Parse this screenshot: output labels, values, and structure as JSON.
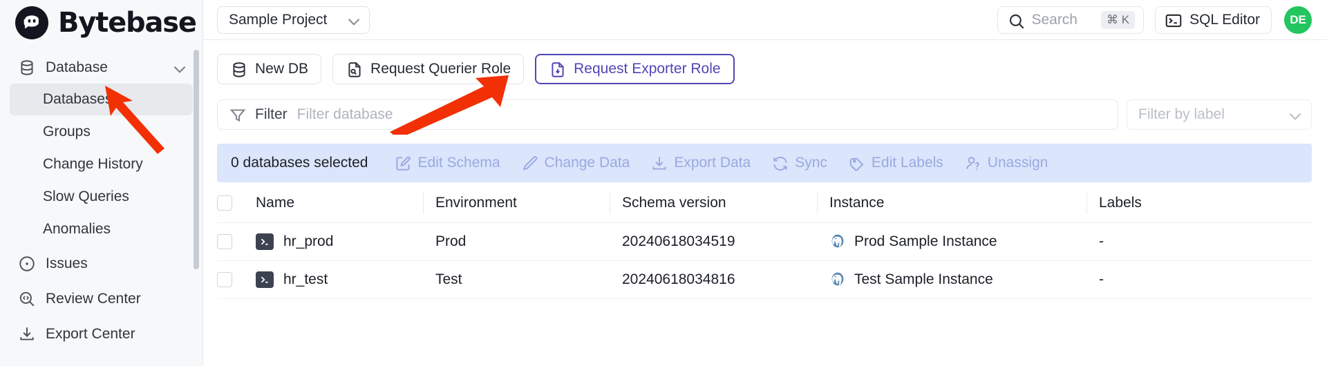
{
  "brand": {
    "name": "Bytebase",
    "logo_icon": "bytebase-logo-icon"
  },
  "sidebar": {
    "group": {
      "label": "Database",
      "icon": "database-icon",
      "chevron": "chevron-down-icon"
    },
    "sub_items": [
      {
        "label": "Databases",
        "active": true
      },
      {
        "label": "Groups",
        "active": false
      },
      {
        "label": "Change History",
        "active": false
      },
      {
        "label": "Slow Queries",
        "active": false
      },
      {
        "label": "Anomalies",
        "active": false
      }
    ],
    "items": [
      {
        "label": "Issues",
        "icon": "issues-circle-dot-icon"
      },
      {
        "label": "Review Center",
        "icon": "review-code-search-icon"
      },
      {
        "label": "Export Center",
        "icon": "export-download-icon"
      }
    ]
  },
  "topbar": {
    "project": {
      "value": "Sample Project",
      "chevron": "chevron-down-icon"
    },
    "search": {
      "placeholder": "Search",
      "shortcut": "⌘ K",
      "icon": "search-icon"
    },
    "sql_editor": {
      "label": "SQL Editor",
      "icon": "terminal-icon"
    },
    "avatar": {
      "initials": "DE",
      "color": "#22c55e"
    }
  },
  "toolbar": {
    "buttons": [
      {
        "label": "New DB",
        "icon": "database-icon",
        "focused": false
      },
      {
        "label": "Request Querier Role",
        "icon": "file-search-icon",
        "focused": false
      },
      {
        "label": "Request Exporter Role",
        "icon": "file-download-icon",
        "focused": true
      }
    ],
    "focus_color": "#4f46b5"
  },
  "filters": {
    "filter_label": "Filter",
    "filter_icon": "funnel-icon",
    "filter_placeholder": "Filter database",
    "filter_value": "",
    "label_placeholder": "Filter by label",
    "label_chevron": "chevron-down-icon"
  },
  "actionbar": {
    "background": "#dbe5fb",
    "selection_text": "0 databases selected",
    "actions": [
      {
        "label": "Edit Schema",
        "icon": "edit-schema-icon"
      },
      {
        "label": "Change Data",
        "icon": "pencil-icon"
      },
      {
        "label": "Export Data",
        "icon": "download-icon"
      },
      {
        "label": "Sync",
        "icon": "sync-refresh-icon"
      },
      {
        "label": "Edit Labels",
        "icon": "tag-icon"
      },
      {
        "label": "Unassign",
        "icon": "unassign-icon"
      }
    ]
  },
  "table": {
    "columns": [
      "Name",
      "Environment",
      "Schema version",
      "Instance",
      "Labels"
    ],
    "rows": [
      {
        "selected": false,
        "name": "hr_prod",
        "name_icon": "sql-console-icon",
        "environment": "Prod",
        "schema_version": "20240618034519",
        "instance": "Prod Sample Instance",
        "instance_icon": "postgres-icon",
        "labels": "-"
      },
      {
        "selected": false,
        "name": "hr_test",
        "name_icon": "sql-console-icon",
        "environment": "Test",
        "schema_version": "20240618034816",
        "instance": "Test Sample Instance",
        "instance_icon": "postgres-icon",
        "labels": "-"
      }
    ]
  },
  "annotations": {
    "arrow_color": "#f23005",
    "arrows": [
      {
        "name": "arrow-to-databases",
        "points_to": "Databases"
      },
      {
        "name": "arrow-to-request-exporter-role",
        "points_to": "Request Exporter Role"
      }
    ]
  }
}
